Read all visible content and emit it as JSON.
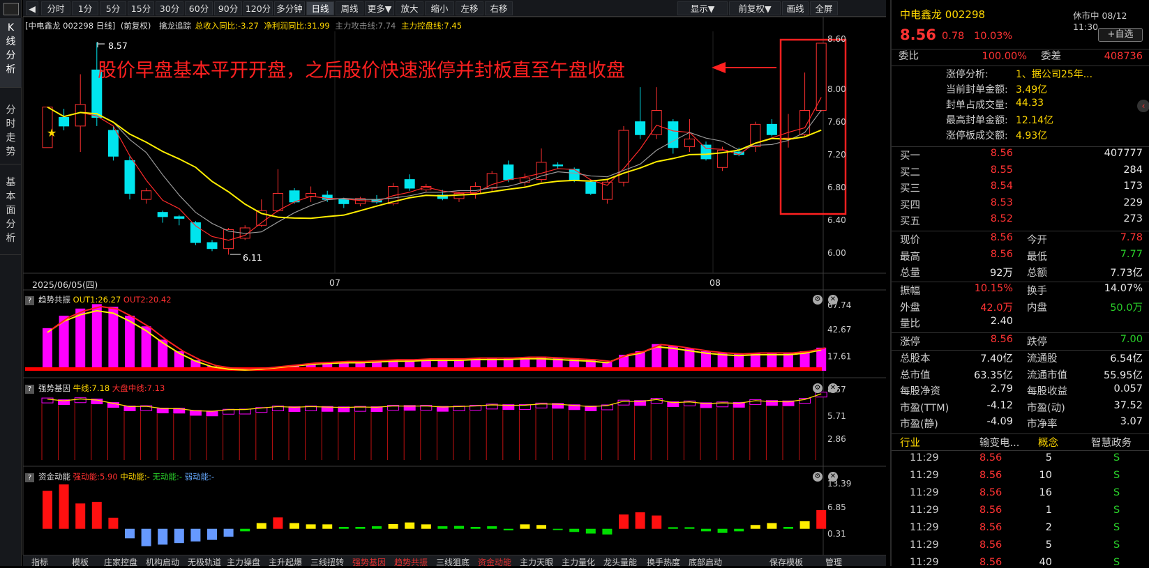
{
  "toolbar": {
    "buttons": [
      "分时",
      "1分",
      "5分",
      "15分",
      "30分",
      "60分",
      "90分",
      "120分",
      "多分钟",
      "日线",
      "周线",
      "更多▼",
      "放大",
      "缩小",
      "左移",
      "右移"
    ],
    "right_buttons": [
      "显示▼",
      "前复权▼",
      "画线",
      "全屏"
    ],
    "active": "日线"
  },
  "left_tabs": [
    {
      "label": "K线分析",
      "active": true
    },
    {
      "label": "分时走势",
      "active": false
    },
    {
      "label": "基本面分析",
      "active": false
    }
  ],
  "kline_info": {
    "stock": "[中电鑫龙 002298 日线]",
    "adj": "(前复权)",
    "indicator": "擒龙追踪",
    "rev": "总收入同比:-3.27",
    "profit": "净利润同比:31.99",
    "attack": "主力攻击线:7.74",
    "control": "主力控盘线:7.45"
  },
  "annotation": "股价早盘基本平开开盘，之后股价快速涨停并封板直至午盘收盘",
  "price_axis": [
    "8.60",
    "8.00",
    "7.60",
    "7.20",
    "6.80",
    "6.40",
    "6.00"
  ],
  "hi_label": "8.57",
  "lo_label": "6.11",
  "date_axis": {
    "start": "2025/06/05(四)",
    "m1": "07",
    "m2": "08"
  },
  "chart_data": [
    {
      "type": "candlestick",
      "title": "中电鑫龙 002298 日线",
      "ylim": [
        6.0,
        8.6
      ],
      "ohlc": [
        [
          7.35,
          7.82,
          7.35,
          7.82
        ],
        [
          7.7,
          7.6,
          7.55,
          7.8
        ],
        [
          7.6,
          7.85,
          7.3,
          8.2
        ],
        [
          8.25,
          7.7,
          7.6,
          8.57
        ],
        [
          7.55,
          7.25,
          7.2,
          7.6
        ],
        [
          7.2,
          6.82,
          6.75,
          7.25
        ],
        [
          6.75,
          6.85,
          6.7,
          6.88
        ],
        [
          6.6,
          6.55,
          6.48,
          6.62
        ],
        [
          6.55,
          6.53,
          6.45,
          6.57
        ],
        [
          6.48,
          6.25,
          6.22,
          6.5
        ],
        [
          6.25,
          6.18,
          6.15,
          6.28
        ],
        [
          6.18,
          6.4,
          6.11,
          6.42
        ],
        [
          6.3,
          6.42,
          6.28,
          6.45
        ],
        [
          6.45,
          6.62,
          6.43,
          6.75
        ],
        [
          6.62,
          6.82,
          6.6,
          7.1
        ],
        [
          6.85,
          6.72,
          6.7,
          6.88
        ],
        [
          6.78,
          6.82,
          6.72,
          6.9
        ],
        [
          6.8,
          6.75,
          6.72,
          6.85
        ],
        [
          6.75,
          6.7,
          6.65,
          6.77
        ],
        [
          6.7,
          6.76,
          6.67,
          6.78
        ],
        [
          6.75,
          6.72,
          6.7,
          6.8
        ],
        [
          6.7,
          6.9,
          6.68,
          6.94
        ],
        [
          6.98,
          6.88,
          6.85,
          7.04
        ],
        [
          6.86,
          6.9,
          6.84,
          6.93
        ],
        [
          6.8,
          6.76,
          6.74,
          6.86
        ],
        [
          6.76,
          6.82,
          6.72,
          6.84
        ],
        [
          6.82,
          6.9,
          6.76,
          6.95
        ],
        [
          6.88,
          7.05,
          6.84,
          7.08
        ],
        [
          7.15,
          6.98,
          6.95,
          7.2
        ],
        [
          6.95,
          7.0,
          6.9,
          7.05
        ],
        [
          6.98,
          7.18,
          6.95,
          7.34
        ],
        [
          7.15,
          7.14,
          7.1,
          7.18
        ],
        [
          7.1,
          6.97,
          6.95,
          7.12
        ],
        [
          6.95,
          6.82,
          6.8,
          6.98
        ],
        [
          6.75,
          6.95,
          6.7,
          6.99
        ],
        [
          6.95,
          7.55,
          6.9,
          7.6
        ],
        [
          7.65,
          7.5,
          7.45,
          8.05
        ],
        [
          7.5,
          7.78,
          7.45,
          8.05
        ],
        [
          7.65,
          7.35,
          7.28,
          7.68
        ],
        [
          7.36,
          7.45,
          7.3,
          7.68
        ],
        [
          7.38,
          7.22,
          7.2,
          7.42
        ],
        [
          7.12,
          7.32,
          7.08,
          7.36
        ],
        [
          7.3,
          7.27,
          7.25,
          7.35
        ],
        [
          7.36,
          7.62,
          7.3,
          7.65
        ],
        [
          7.62,
          7.5,
          7.48,
          7.68
        ],
        [
          7.45,
          7.46,
          7.35,
          7.74
        ],
        [
          7.5,
          7.78,
          7.48,
          8.22
        ],
        [
          7.78,
          8.56,
          7.77,
          8.56
        ]
      ]
    },
    {
      "type": "bar",
      "title": "趋势共振",
      "legend": [
        "OUT1:26.27",
        "OUT2:20.42"
      ],
      "yticks": [
        "67.74",
        "42.67",
        "17.61"
      ],
      "ylim": [
        0,
        80
      ],
      "values": [
        48,
        62,
        70,
        75,
        72,
        62,
        50,
        35,
        22,
        12,
        5,
        2,
        1,
        2,
        4,
        6,
        8,
        9,
        10,
        10,
        11,
        12,
        12,
        13,
        13,
        13,
        14,
        14,
        14,
        15,
        15,
        14,
        13,
        12,
        10,
        18,
        22,
        30,
        28,
        25,
        22,
        20,
        19,
        20,
        20,
        20,
        22,
        26
      ]
    },
    {
      "type": "bar",
      "title": "强势基因",
      "legend": [
        "牛线:7.18",
        "大盘中线:7.13"
      ],
      "yticks": [
        "8.57",
        "5.71",
        "2.86"
      ],
      "ylim": [
        0,
        9.5
      ],
      "values": [
        7.82,
        7.6,
        7.85,
        7.7,
        7.25,
        6.82,
        6.85,
        6.55,
        6.53,
        6.25,
        6.18,
        6.4,
        6.42,
        6.62,
        6.82,
        6.72,
        6.82,
        6.75,
        6.7,
        6.76,
        6.72,
        6.9,
        6.88,
        6.9,
        6.76,
        6.82,
        6.9,
        7.05,
        6.98,
        7.0,
        7.18,
        7.14,
        6.97,
        6.82,
        6.95,
        7.55,
        7.5,
        7.78,
        7.35,
        7.45,
        7.22,
        7.32,
        7.27,
        7.62,
        7.5,
        7.46,
        7.78,
        8.56
      ]
    },
    {
      "type": "bar",
      "title": "资金动能",
      "legend": [
        "强动能:5.90",
        "中动能:-",
        "无动能:-",
        "弱动能:-"
      ],
      "yticks": [
        "13.39",
        "6.85",
        "0.31"
      ],
      "ylim": [
        -6,
        16
      ],
      "values": [
        12,
        14,
        8,
        8.5,
        3.5,
        -3,
        -5.5,
        -5,
        -4.5,
        -4,
        -3.5,
        -2.5,
        -0.8,
        1.8,
        3.6,
        1.8,
        1.4,
        1.4,
        0.6,
        0.6,
        0.8,
        1.5,
        2,
        1.4,
        0.8,
        0.9,
        0.6,
        0.8,
        -0.5,
        1.4,
        1.2,
        -0.4,
        -1,
        -1.5,
        -1.8,
        4.5,
        5.2,
        4.2,
        0.5,
        0.5,
        -0.8,
        -1.3,
        -0.8,
        1.2,
        1.8,
        0.6,
        2.4,
        5.9
      ]
    }
  ],
  "sub_panels": [
    {
      "title": "趋势共振",
      "out1": "OUT1:26.27",
      "out2": "OUT2:20.42"
    },
    {
      "title": "强势基因",
      "l1": "牛线:7.18",
      "l2": "大盘中线:7.13"
    },
    {
      "title": "资金动能",
      "l1": "强动能:5.90",
      "l2": "中动能:-",
      "l3": "无动能:-",
      "l4": "弱动能:-"
    }
  ],
  "bottom_tabs": [
    "指标",
    "模板",
    "庄家控盘",
    "机构启动",
    "无极轨道",
    "主力操盘",
    "主升起爆",
    "三线扭转",
    "强势基因",
    "趋势共振",
    "三线狙底",
    "资金动能",
    "主力天眼",
    "主力量化",
    "龙头量能",
    "换手热度",
    "底部启动",
    "保存模板",
    "管理"
  ],
  "right": {
    "name": "中电鑫龙",
    "code": "002298",
    "time": "休市中 08/12 11:30",
    "price": "8.56",
    "change": "0.78",
    "pct": "10.03%",
    "fav": "+自选",
    "weibi_label": "委比",
    "weibi": "100.00%",
    "weicha_label": "委差",
    "weicha": "408736",
    "zt_info": [
      [
        "涨停分析:",
        "1、据公司25年..."
      ],
      [
        "当前封单金额:",
        "3.49亿"
      ],
      [
        "封单占成交量:",
        "44.33"
      ],
      [
        "最高封单金额:",
        "12.14亿"
      ],
      [
        "涨停板成交额:",
        "4.93亿"
      ]
    ],
    "bids": [
      [
        "买一",
        "8.56",
        "407777"
      ],
      [
        "买二",
        "8.55",
        "284"
      ],
      [
        "买三",
        "8.54",
        "173"
      ],
      [
        "买四",
        "8.53",
        "229"
      ],
      [
        "买五",
        "8.52",
        "273"
      ]
    ],
    "quote": [
      [
        "现价",
        "8.56",
        "今开",
        "7.78"
      ],
      [
        "最高",
        "8.56",
        "最低",
        "7.77"
      ],
      [
        "总量",
        "92万",
        "总额",
        "7.73亿"
      ]
    ],
    "quote2": [
      [
        "振幅",
        "10.15%",
        "换手",
        "14.07%"
      ],
      [
        "外盘",
        "42.0万",
        "内盘",
        "50.0万"
      ],
      [
        "量比",
        "2.40",
        "",
        ""
      ]
    ],
    "limits": [
      "涨停",
      "8.56",
      "跌停",
      "7.00"
    ],
    "fund": [
      [
        "总股本",
        "7.40亿",
        "流通股",
        "6.54亿"
      ],
      [
        "总市值",
        "63.35亿",
        "流通市值",
        "55.95亿"
      ],
      [
        "每股净资",
        "2.79",
        "每股收益",
        "0.057"
      ],
      [
        "市盈(TTM)",
        "-4.12",
        "市盈(动)",
        "37.52"
      ],
      [
        "市盈(静)",
        "-4.09",
        "市净率",
        "3.07"
      ]
    ],
    "industry": [
      "行业",
      "输变电...",
      "概念",
      "智慧政务"
    ],
    "ticks": [
      [
        "11:29",
        "8.56",
        "5",
        "S"
      ],
      [
        "11:29",
        "8.56",
        "10",
        "S"
      ],
      [
        "11:29",
        "8.56",
        "16",
        "S"
      ],
      [
        "11:29",
        "8.56",
        "1",
        "S"
      ],
      [
        "11:29",
        "8.56",
        "2",
        "S"
      ],
      [
        "11:29",
        "8.56",
        "5",
        "S"
      ],
      [
        "11:29",
        "8.56",
        "40",
        "S"
      ]
    ]
  }
}
